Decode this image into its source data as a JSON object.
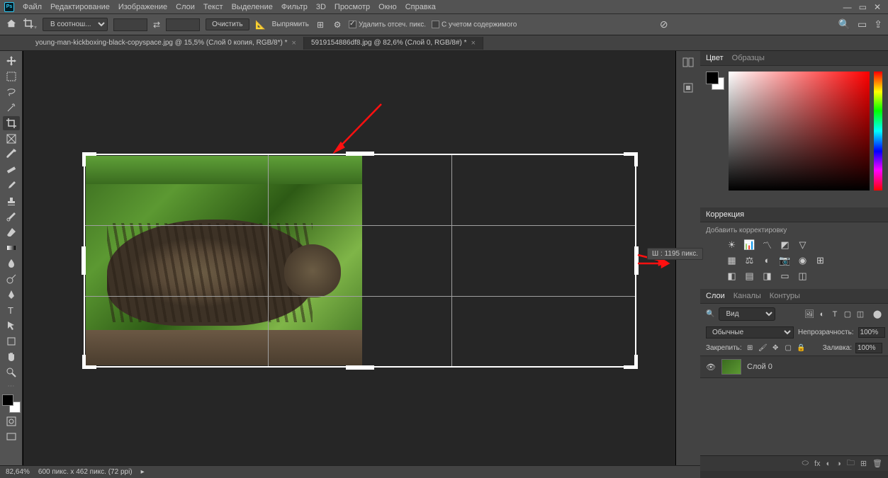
{
  "menu": {
    "items": [
      "Файл",
      "Редактирование",
      "Изображение",
      "Слои",
      "Текст",
      "Выделение",
      "Фильтр",
      "3D",
      "Просмотр",
      "Окно",
      "Справка"
    ]
  },
  "options": {
    "ratio": "В соотнош...",
    "clear": "Очистить",
    "straighten": "Выпрямить",
    "deleteCropped": "Удалить отсеч. пикс.",
    "contentAware": "С учетом содержимого"
  },
  "tabs": {
    "inactive": "young-man-kickboxing-black-copyspace.jpg @ 15,5% (Слой 0 копия, RGB/8*) *",
    "active": "5919154886df8.jpg @ 82,6% (Слой 0, RGB/8#) *"
  },
  "tooltip": "Ш :  1195 пикс.",
  "status": {
    "zoom": "82,64%",
    "info": "600 пикс. x 462 пикс. (72 ppi)"
  },
  "panels": {
    "colorTabs": [
      "Цвет",
      "Образцы"
    ],
    "corrections": {
      "title": "Коррекция",
      "sub": "Добавить корректировку"
    },
    "layerTabs": [
      "Слои",
      "Каналы",
      "Контуры"
    ],
    "layerSearch": "Вид",
    "blend": "Обычные",
    "opacityLabel": "Непрозрачность:",
    "opacity": "100%",
    "lockLabel": "Закрепить:",
    "fillLabel": "Заливка:",
    "fill": "100%",
    "layerName": "Слой 0"
  }
}
